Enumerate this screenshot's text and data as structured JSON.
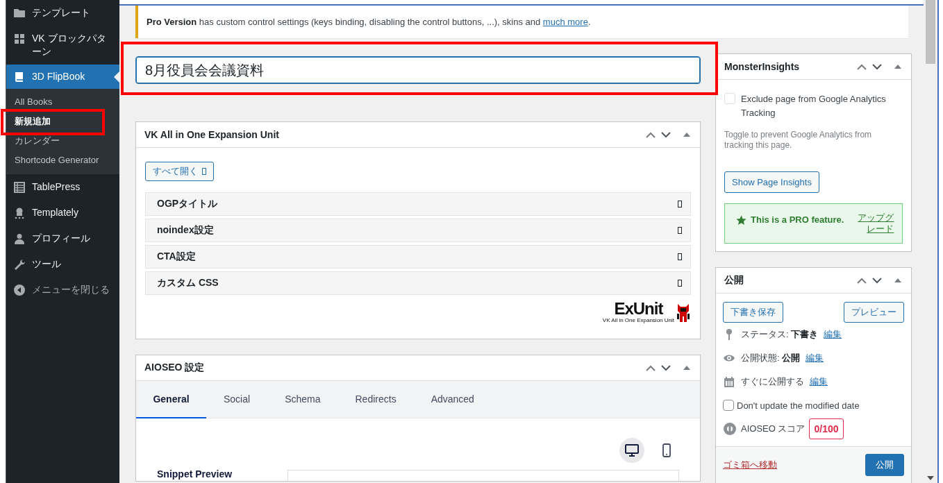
{
  "sidebar": {
    "items": [
      {
        "label": "テンプレート",
        "kind": "menu",
        "selected": false
      },
      {
        "label": "VK ブロックパターン",
        "kind": "menu",
        "selected": false
      },
      {
        "label": "3D FlipBook",
        "kind": "menu",
        "selected": true,
        "children": [
          {
            "label": "All Books",
            "selected": false,
            "highlighted": false
          },
          {
            "label": "新規追加",
            "selected": true,
            "highlighted": true
          },
          {
            "label": "カレンダー",
            "selected": false,
            "highlighted": false
          },
          {
            "label": "Shortcode Generator",
            "selected": false,
            "highlighted": false
          }
        ]
      },
      {
        "label": "TablePress",
        "kind": "menu",
        "selected": false
      },
      {
        "label": "Templately",
        "kind": "menu",
        "selected": false
      },
      {
        "label": "プロフィール",
        "kind": "menu",
        "selected": false
      },
      {
        "label": "ツール",
        "kind": "menu",
        "selected": false
      },
      {
        "label": "メニューを閉じる",
        "kind": "collapse",
        "selected": false
      }
    ]
  },
  "notice": {
    "text": "**Pro Version** has custom control settings (keys binding, disabling the control buttons, ...), skins and ",
    "link": "much more",
    "tail": "."
  },
  "title_field": {
    "value": "8月役員会会議資料",
    "highlighted": true
  },
  "vk_box": {
    "title": "VK All in One Expansion Unit",
    "expand_all_button": "すべて開く",
    "sections": [
      "OGPタイトル",
      "noindex設定",
      "CTA設定",
      "カスタム CSS"
    ],
    "logo": "ExUnit",
    "logo_caption": "VK All in One Expansion Unit"
  },
  "aioseo_box": {
    "title": "AIOSEO 設定",
    "tabs": [
      {
        "label": "General",
        "selected": true
      },
      {
        "label": "Social",
        "selected": false
      },
      {
        "label": "Schema",
        "selected": false
      },
      {
        "label": "Redirects",
        "selected": false
      },
      {
        "label": "Advanced",
        "selected": false
      }
    ],
    "devices": [
      {
        "kind": "desktop",
        "selected": true
      },
      {
        "kind": "mobile",
        "selected": false
      }
    ],
    "preview_label": "Snippet Preview"
  },
  "monsterinsights_box": {
    "title": "MonsterInsights",
    "exclude": {
      "label": "Exclude page from Google Analytics Tracking",
      "checked": false
    },
    "help": "Toggle to prevent Google Analytics from tracking this page.",
    "button": "Show Page Insights",
    "pro_notice": {
      "text": "This is a PRO feature.",
      "link": "アップグレード"
    }
  },
  "publish_box": {
    "title": "公開",
    "save_draft": "下書き保存",
    "preview": "プレビュー",
    "rows": [
      {
        "kind": "status",
        "label": "ステータス:",
        "value": "下書き",
        "link": "編集"
      },
      {
        "kind": "visibility",
        "label": "公開状態:",
        "value": "公開",
        "link": "編集"
      },
      {
        "kind": "schedule",
        "label": "すぐに公開する",
        "link": "編集"
      }
    ],
    "keep_modified": {
      "label": "Don't update the modified date",
      "checked": false
    },
    "score": {
      "label": "AIOSEO スコア",
      "value": "0/100"
    },
    "trash": "ゴミ箱へ移動",
    "publish": "公開"
  }
}
